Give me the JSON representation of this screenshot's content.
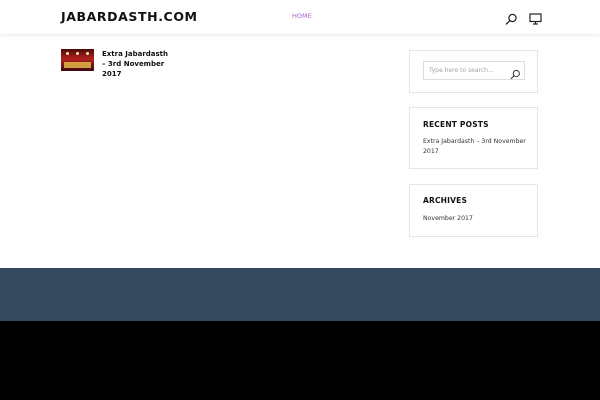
{
  "header": {
    "site_title": "JABARDASTH.COM",
    "nav": {
      "home_label": "HOME"
    },
    "icons": {
      "search": "search-icon",
      "screen": "monitor-icon"
    },
    "nav_active_color": "#a861c9"
  },
  "main": {
    "posts": [
      {
        "title": "Extra Jabardasth – 3rd November 2017",
        "thumbnail": "stage-show-thumbnail"
      }
    ]
  },
  "sidebar": {
    "search": {
      "placeholder": "Type here to search...",
      "icon": "search-icon"
    },
    "recent_posts": {
      "title": "RECENT POSTS",
      "items": [
        "Extra Jabardasth – 3rd November 2017"
      ]
    },
    "archives": {
      "title": "ARCHIVES",
      "items": [
        "November 2017"
      ]
    }
  },
  "footer": {
    "top_color": "#34495e",
    "bottom_color": "#000000"
  }
}
